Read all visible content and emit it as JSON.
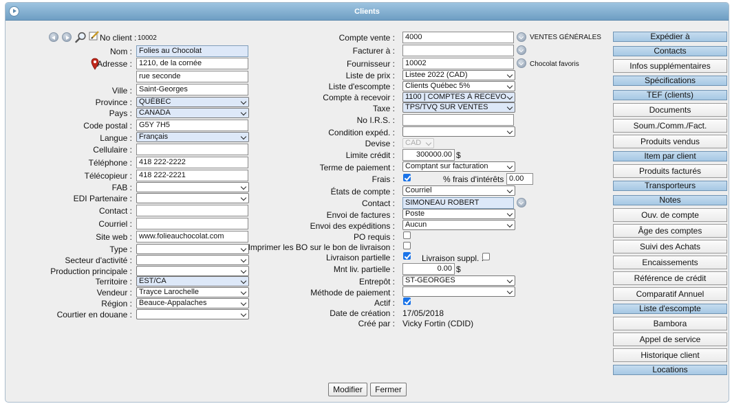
{
  "window": {
    "title": "Clients"
  },
  "left": {
    "client_no": {
      "label": "No client :",
      "value": "10002"
    },
    "nom": {
      "label": "Nom :",
      "value": "Folies au Chocolat"
    },
    "adresse": {
      "label": "Adresse :",
      "line1": "1210, de la cornée",
      "line2": "rue seconde"
    },
    "ville": {
      "label": "Ville :",
      "value": "Saint-Georges"
    },
    "province": {
      "label": "Province :",
      "value": "QUÉBEC"
    },
    "pays": {
      "label": "Pays :",
      "value": "CANADA"
    },
    "code_postal": {
      "label": "Code postal :",
      "value": "G5Y 7H5"
    },
    "langue": {
      "label": "Langue :",
      "value": "Français"
    },
    "cellulaire": {
      "label": "Cellulaire :",
      "value": ""
    },
    "telephone": {
      "label": "Téléphone :",
      "value": "418 222-2222"
    },
    "telecopieur": {
      "label": "Télécopieur :",
      "value": "418 222-2221"
    },
    "fab": {
      "label": "FAB :",
      "value": ""
    },
    "edi": {
      "label": "EDI Partenaire :",
      "value": ""
    },
    "contact": {
      "label": "Contact :",
      "value": ""
    },
    "courriel": {
      "label": "Courriel :",
      "value": ""
    },
    "site_web": {
      "label": "Site web :",
      "value": "www.folieauchocolat.com"
    },
    "type": {
      "label": "Type :",
      "value": ""
    },
    "secteur": {
      "label": "Secteur d'activité :",
      "value": ""
    },
    "production": {
      "label": "Production principale :",
      "value": ""
    },
    "territoire": {
      "label": "Territoire :",
      "value": "EST/CA"
    },
    "vendeur": {
      "label": "Vendeur :",
      "value": "Trayce Larochelle"
    },
    "region": {
      "label": "Région :",
      "value": "Beauce-Appalaches"
    },
    "courtier": {
      "label": "Courtier en douane :",
      "value": ""
    }
  },
  "middle": {
    "compte_vente": {
      "label": "Compte vente :",
      "value": "4000",
      "note": "VENTES GÉNÉRALES"
    },
    "facturer_a": {
      "label": "Facturer à :",
      "value": ""
    },
    "fournisseur": {
      "label": "Fournisseur :",
      "value": "10002",
      "note": "Chocolat favoris"
    },
    "liste_prix": {
      "label": "Liste de prix :",
      "value": "Listee 2022 (CAD)"
    },
    "liste_escompte": {
      "label": "Liste d'escompte :",
      "value": "Clients Québec 5%"
    },
    "compte_recevoir": {
      "label": "Compte à recevoir :",
      "value": "1100 | COMPTES À RECEVO"
    },
    "taxe": {
      "label": "Taxe :",
      "value": "TPS/TVQ SUR VENTES"
    },
    "no_irs": {
      "label": "No I.R.S. :",
      "value": ""
    },
    "condition_exped": {
      "label": "Condition expéd. :",
      "value": ""
    },
    "devise": {
      "label": "Devise :",
      "value": "CAD"
    },
    "limite_credit": {
      "label": "Limite crédit :",
      "value": "300000.00",
      "unit": "$"
    },
    "terme_paiement": {
      "label": "Terme de paiement :",
      "value": "Comptant sur facturation"
    },
    "frais": {
      "label": "Frais :",
      "checked": true,
      "pct_label": "% frais d'intérêts :",
      "pct_value": "0.00"
    },
    "etats_compte": {
      "label": "États de compte :",
      "value": "Courriel"
    },
    "contact": {
      "label": "Contact :",
      "value": "SIMONEAU ROBERT"
    },
    "envoi_factures": {
      "label": "Envoi de factures :",
      "value": "Poste"
    },
    "envoi_expeditions": {
      "label": "Envoi des expéditions :",
      "value": "Aucun"
    },
    "po_requis": {
      "label": "PO requis :",
      "checked": false
    },
    "imprimer_bo": {
      "label": "Imprimer les BO sur le bon de livraison :",
      "checked": false
    },
    "livraison_partielle": {
      "label": "Livraison partielle :",
      "checked": true,
      "suppl_label": "Livraison suppl. :",
      "suppl_checked": false
    },
    "mnt_liv_partielle": {
      "label": "Mnt liv. partielle :",
      "value": "0.00",
      "unit": "$"
    },
    "entrepot": {
      "label": "Entrepôt :",
      "value": "ST-GEORGES"
    },
    "methode_paiement": {
      "label": "Méthode de paiement :",
      "value": ""
    },
    "actif": {
      "label": "Actif :",
      "checked": true
    },
    "date_creation": {
      "label": "Date de création :",
      "value": "17/05/2018"
    },
    "cree_par": {
      "label": "Créé par :",
      "value": "Vicky Fortin (CDID)"
    }
  },
  "right_buttons": [
    {
      "label": "Expédier à",
      "style": "blue"
    },
    {
      "label": "Contacts",
      "style": "blue"
    },
    {
      "label": "Infos supplémentaires",
      "style": "grey"
    },
    {
      "label": "Spécifications",
      "style": "blue"
    },
    {
      "label": "TEF (clients)",
      "style": "blue"
    },
    {
      "label": "Documents",
      "style": "grey"
    },
    {
      "label": "Soum./Comm./Fact.",
      "style": "grey"
    },
    {
      "label": "Produits vendus",
      "style": "grey"
    },
    {
      "label": "Item par client",
      "style": "blue"
    },
    {
      "label": "Produits facturés",
      "style": "grey"
    },
    {
      "label": "Transporteurs",
      "style": "blue"
    },
    {
      "label": "Notes",
      "style": "blue"
    },
    {
      "label": "Ouv. de compte",
      "style": "grey"
    },
    {
      "label": "Âge des comptes",
      "style": "grey"
    },
    {
      "label": "Suivi des Achats",
      "style": "grey"
    },
    {
      "label": "Encaissements",
      "style": "grey"
    },
    {
      "label": "Référence de crédit",
      "style": "grey"
    },
    {
      "label": "Comparatif Annuel",
      "style": "grey"
    },
    {
      "label": "Liste d'escompte",
      "style": "blue"
    },
    {
      "label": "Bambora",
      "style": "grey"
    },
    {
      "label": "Appel de service",
      "style": "grey"
    },
    {
      "label": "Historique client",
      "style": "grey"
    },
    {
      "label": "Locations",
      "style": "blue"
    }
  ],
  "bottom": {
    "modifier": "Modifier",
    "fermer": "Fermer"
  }
}
